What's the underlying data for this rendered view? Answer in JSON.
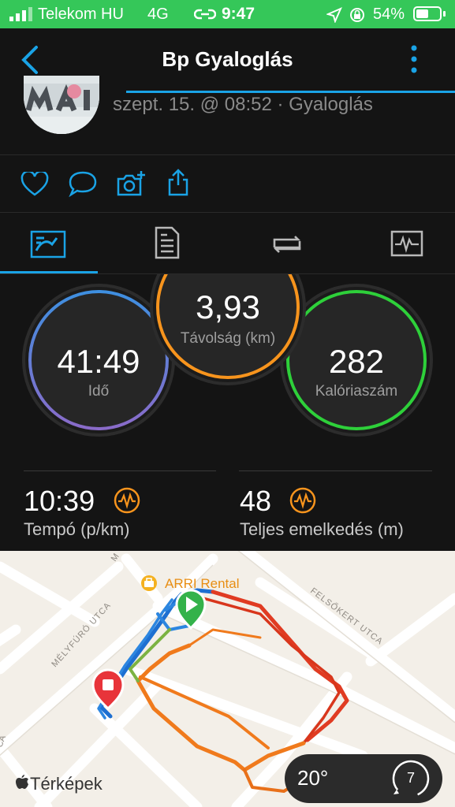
{
  "status_bar": {
    "carrier": "Telekom HU",
    "network": "4G",
    "time": "9:47",
    "battery": "54%",
    "battery_level": 0.54
  },
  "nav": {
    "title": "Bp Gyaloglás"
  },
  "activity": {
    "meta": "szept. 15. @ 08:52 · Gyaloglás"
  },
  "circles": {
    "time": {
      "value": "41:49",
      "label": "Idő"
    },
    "distance": {
      "value": "3,93",
      "label": "Távolság (km)"
    },
    "calories": {
      "value": "282",
      "label": "Kalóriaszám"
    }
  },
  "stats": {
    "pace": {
      "value": "10:39",
      "label": "Tempó (p/km)"
    },
    "elevation": {
      "value": "48",
      "label": "Teljes emelkedés (m)"
    }
  },
  "map": {
    "poi": "ARRI Rental",
    "streets": {
      "melyfuro": "MÉLYFÚRÓ UTCA",
      "felsokert": "FELSŐKERT UTCA",
      "partial_left": "CA",
      "partial_top": "M"
    },
    "attribution": "Térképek",
    "weather": {
      "temp": "20°",
      "wind": "7"
    }
  },
  "colors": {
    "accent_blue": "#1aa3e6",
    "status_green": "#35c759",
    "ring_orange": "#f7941d",
    "ring_green": "#2ed03a",
    "ring_blue": "#3e8fe0",
    "ring_purple": "#8a6bc9"
  }
}
